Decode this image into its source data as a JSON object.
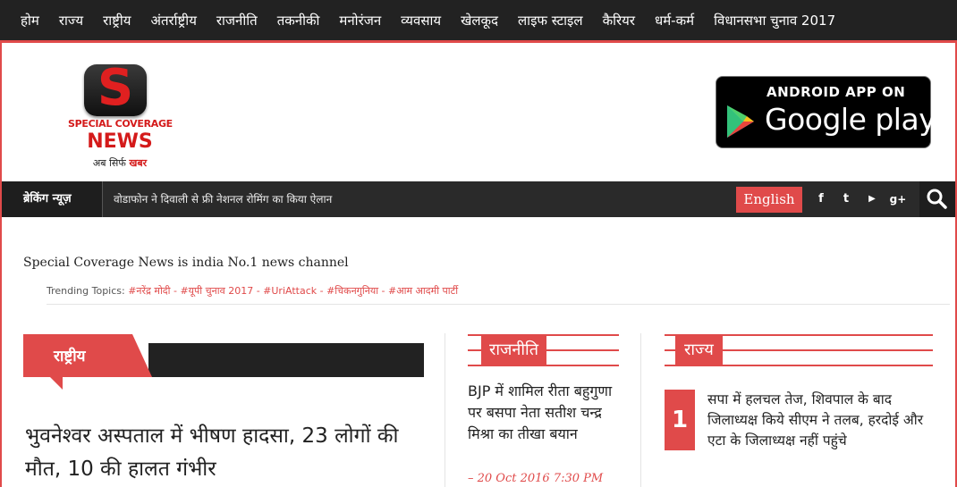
{
  "nav": {
    "items": [
      "होम",
      "राज्य",
      "राष्ट्रीय",
      "अंतर्राष्ट्रीय",
      "राजनीति",
      "तकनीकी",
      "मनोरंजन",
      "व्यवसाय",
      "खेलकूद",
      "लाइफ स्टाइल",
      "कैरियर",
      "धर्म-कर्म",
      "विधानसभा चुनाव 2017"
    ]
  },
  "logo": {
    "emblem_letter": "S",
    "line1": "SPECIAL COVERAGE",
    "line2": "NEWS",
    "line3_prefix": "अब सिर्फ",
    "line3_highlight": "खबर"
  },
  "app_badge": {
    "line1": "ANDROID APP ON",
    "line2": "Google play"
  },
  "breaking": {
    "label": "ब्रेकिंग न्यूज़",
    "text": "वोडाफोन ने दिवाली से फ्री नेशनल रोमिंग का किया ऐलान",
    "english_button": "English",
    "social": [
      "f",
      "t",
      "▶",
      "g+"
    ]
  },
  "tagline": "Special Coverage News is india No.1 news channel",
  "trending": {
    "label": "Trending Topics:",
    "tags": "#नरेंद्र मोदी - #यूपी चुनाव 2017 - #UriAttack - #चिकनगुनिया - #आम आदमी पार्टी"
  },
  "sections": {
    "national": {
      "title": "राष्ट्रीय",
      "headline": "भुवनेश्वर अस्पताल में भीषण हादसा, 23 लोगों की मौत, 10 की हालत गंभीर"
    },
    "politics": {
      "title": "राजनीति",
      "story": "BJP में शामिल रीता बहुगुणा पर बसपा नेता सतीश चन्द्र मिश्रा का तीखा बयान",
      "date": "– 20 Oct 2016 7:30 PM"
    },
    "state": {
      "title": "राज्य",
      "number": "1",
      "story": "सपा में हलचल तेज, शिवपाल के बाद जिलाध्यक्ष किये सीएम ने तलब, हरदोई और एटा के जिलाध्यक्ष नहीं पहुंचे"
    }
  },
  "colors": {
    "accent": "#e04a4a",
    "dark": "#222222"
  }
}
